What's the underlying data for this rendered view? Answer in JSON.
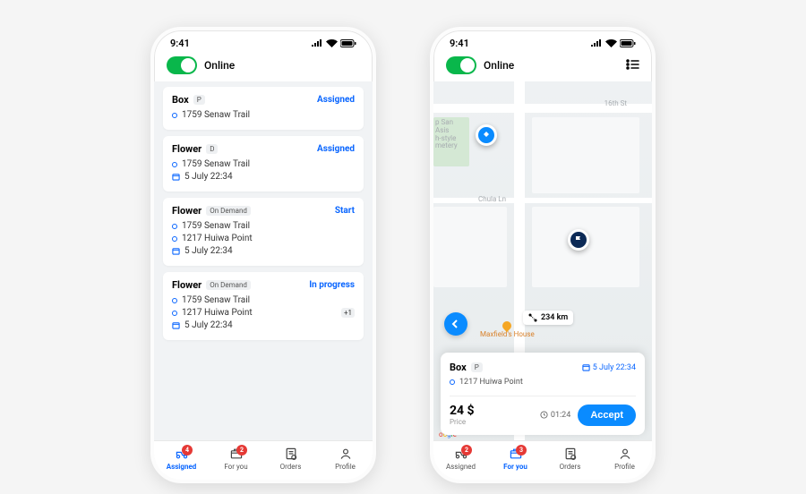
{
  "status_time": "9:41",
  "online_label": "Online",
  "phone1": {
    "cards": [
      {
        "title": "Box",
        "tag": "P",
        "status": "Assigned",
        "addr1": "1759 Senaw Trail",
        "addr2": null,
        "time": null
      },
      {
        "title": "Flower",
        "tag": "D",
        "status": "Assigned",
        "addr1": "1759 Senaw Trail",
        "addr2": null,
        "time": "5 July 22:34"
      },
      {
        "title": "Flower",
        "tag": "On Demand",
        "status": "Start",
        "addr1": "1759 Senaw Trail",
        "addr2": "1217 Huiwa Point",
        "time": "5 July 22:34"
      },
      {
        "title": "Flower",
        "tag": "On Demand",
        "status": "In progress",
        "addr1": "1759 Senaw Trail",
        "addr2": "1217 Huiwa Point",
        "time": "5 July 22:34",
        "extra": "+1"
      }
    ],
    "nav": {
      "items": [
        "Assigned",
        "For you",
        "Orders",
        "Profile"
      ],
      "active": 0,
      "badges": {
        "0": "4",
        "1": "2"
      }
    }
  },
  "phone2": {
    "map": {
      "streets": {
        "top": "16th St",
        "mid": "Chula Ln"
      },
      "cemetery": "p San\nAsis\nh-style\nmetery",
      "poi": "Maxfield's House",
      "distance": "234 km"
    },
    "sheet": {
      "title": "Box",
      "tag": "P",
      "date": "5 July 22:34",
      "addr": "1217 Huiwa Point",
      "price_value": "24 $",
      "price_label": "Price",
      "timer": "01:24",
      "accept": "Accept"
    },
    "attribution": "oogle",
    "nav": {
      "items": [
        "Assigned",
        "For you",
        "Orders",
        "Profile"
      ],
      "active": 1,
      "badges": {
        "0": "2",
        "1": "3"
      }
    }
  }
}
